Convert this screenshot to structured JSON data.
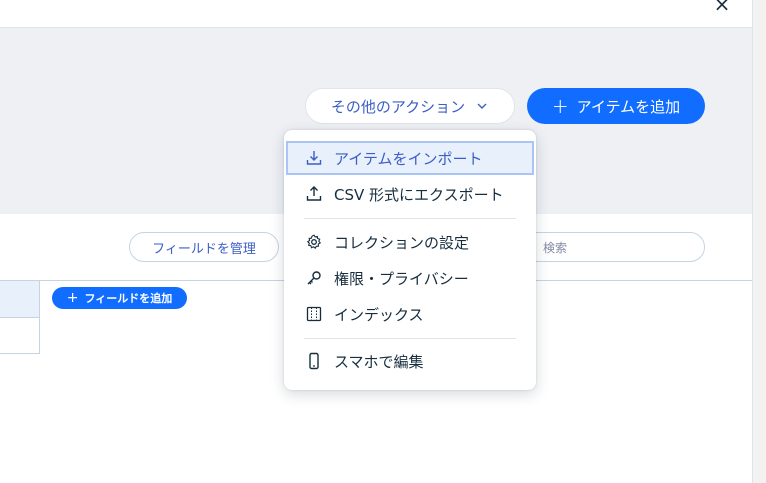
{
  "window": {
    "close_symbol": "×"
  },
  "header": {
    "more_actions_label": "その他のアクション",
    "add_item_label": "アイテムを追加",
    "add_item_symbol": "+"
  },
  "toolbar": {
    "manage_fields_label": "フィールドを管理",
    "search_placeholder": "検索"
  },
  "grid": {
    "add_field_label": "フィールドを追加",
    "add_field_symbol": "+"
  },
  "menu": {
    "items": [
      {
        "label": "アイテムをインポート",
        "icon": "download-icon",
        "highlighted": true
      },
      {
        "label": "CSV 形式にエクスポート",
        "icon": "upload-icon"
      },
      {
        "label": "コレクションの設定",
        "icon": "gear-icon"
      },
      {
        "label": "権限・プライバシー",
        "icon": "key-icon"
      },
      {
        "label": "インデックス",
        "icon": "index-icon"
      },
      {
        "label": "スマホで編集",
        "icon": "smartphone-icon"
      }
    ]
  },
  "colors": {
    "accent": "#116dff",
    "link_text": "#3b5ec7",
    "header_bg": "#eef0f4",
    "highlight_bg": "#e8f0fb"
  }
}
